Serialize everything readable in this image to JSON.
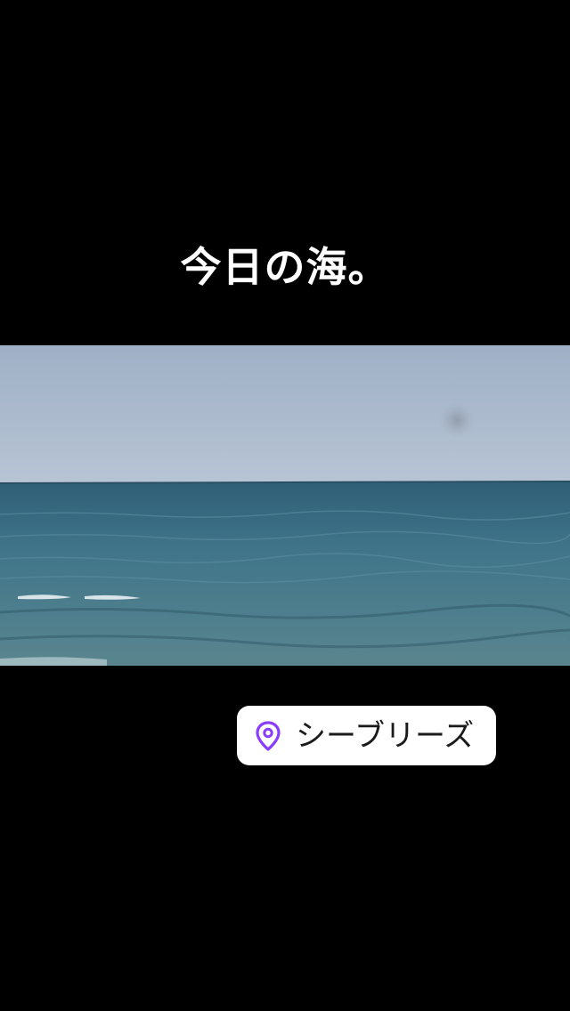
{
  "caption": {
    "text": "今日の海。"
  },
  "photo": {
    "subject": "sea-horizon",
    "sky_color": "#a9b8cc",
    "sea_color": "#3e6f86"
  },
  "location_sticker": {
    "label": "シーブリーズ",
    "icon": "map-pin-icon",
    "accent_color": "#8b3dff"
  }
}
